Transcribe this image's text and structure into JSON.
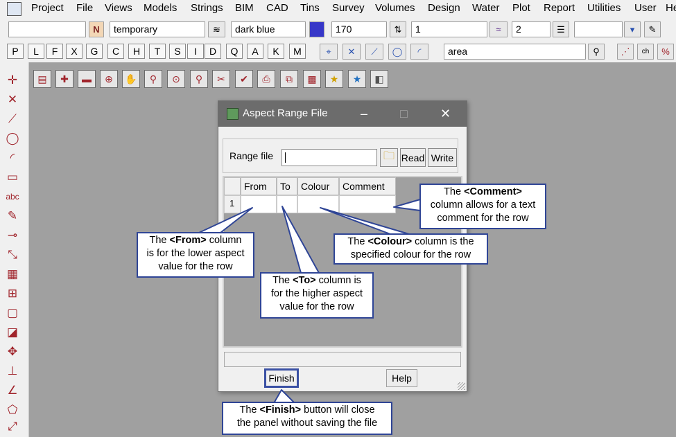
{
  "menu": {
    "items": [
      "Project",
      "File",
      "Views",
      "Models",
      "Strings",
      "BIM",
      "CAD",
      "Tins",
      "Survey",
      "Volumes",
      "Design",
      "Water",
      "Plot",
      "Report",
      "Utilities",
      "User",
      "He"
    ]
  },
  "toolbar1": {
    "field_a": "",
    "name_button": "N",
    "name_field": "temporary",
    "colour_field": "dark blue",
    "colour_swatch": "#3737c8",
    "weight_field": "170",
    "level_field": "1",
    "count_field": "2",
    "last_field": ""
  },
  "toolbar2": {
    "letters": [
      "P",
      "L",
      "F",
      "X",
      "G",
      "C",
      "H",
      "T",
      "S",
      "I",
      "D",
      "Q",
      "A",
      "K",
      "M"
    ],
    "search_field": "area"
  },
  "dialog": {
    "title": "Aspect Range File",
    "minimize": "–",
    "maximize": "□",
    "close": "✕",
    "range_label": "Range file",
    "range_value": "",
    "read_button": "Read",
    "write_button": "Write",
    "columns": [
      "From",
      "To",
      "Colour",
      "Comment"
    ],
    "rows": [
      {
        "number": "1",
        "from": "",
        "to": "",
        "colour": "",
        "comment": ""
      }
    ],
    "status": "",
    "finish_button": "Finish",
    "help_button": "Help"
  },
  "callouts": {
    "comment": {
      "pre": "The ",
      "bold": "<Comment>",
      "line1_post": "",
      "line2": "column allows for a text",
      "line3": "comment for the row"
    },
    "from": {
      "pre": "The ",
      "bold": "<From>",
      "post": " column",
      "line2": "is for the lower aspect",
      "line3": "value for the row"
    },
    "colour": {
      "pre": "The ",
      "bold": "<Colour>",
      "post": " column is the",
      "line2": "specified colour for the row"
    },
    "to": {
      "pre": "The ",
      "bold": "<To>",
      "post": " column is",
      "line2": "for the higher aspect",
      "line3": "value for the row"
    },
    "finish": {
      "pre": "The ",
      "bold": "<Finish>",
      "post": " button will close",
      "line2": "the panel without saving the file"
    }
  },
  "colors": {
    "callout_border": "#2f4596",
    "workspace": "#a0a0a0",
    "titlebar": "#6c6c6c",
    "tool_accent": "#a0242b"
  },
  "icons": {
    "left_toolbar": [
      "point-tool-icon",
      "line-tool-icon",
      "polyline-tool-icon",
      "circle-tool-icon",
      "arc-tool-icon",
      "rectangle-tool-icon",
      "text-tool-icon",
      "paint-tool-icon",
      "label-tool-icon",
      "measure-tool-icon",
      "table-tool-icon",
      "inspect-tool-icon",
      "region-tool-icon",
      "symbol-tool-icon",
      "move-tool-icon",
      "elevation-tool-icon",
      "profile-tool-icon",
      "polygon-tool-icon",
      "transform-tool-icon"
    ],
    "view_toolbar": [
      "save-view-icon",
      "add-view-icon",
      "remove-view-icon",
      "zoom-in-icon",
      "pan-icon",
      "zoom-extent-icon",
      "zoom-window-icon",
      "zoom-out-icon",
      "clean-icon",
      "pick-icon",
      "print-icon",
      "copy-view-icon",
      "grid-icon",
      "favourite-icon",
      "star-icon",
      "layout-icon"
    ]
  }
}
